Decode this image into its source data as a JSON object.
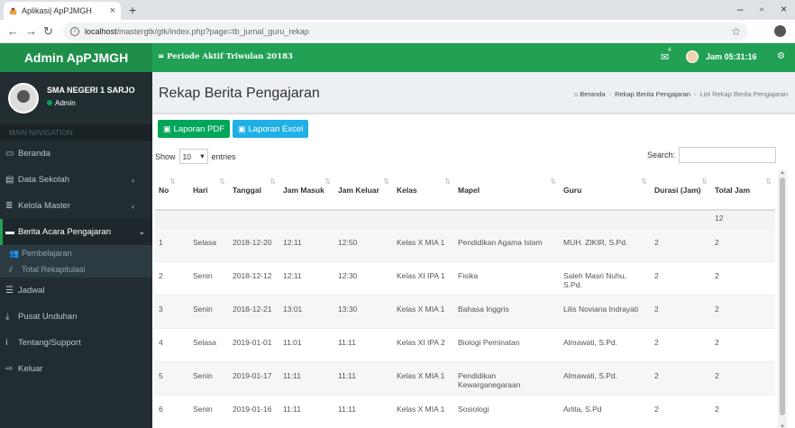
{
  "browser": {
    "tab_title": "Aplikasi| ApPJMGH",
    "url_host": "localhost",
    "url_path": "/mastergtk/gtk/index.php?page=tb_jurnal_guru_rekap"
  },
  "header": {
    "logo": "Admin ApPJMGH",
    "period": "Periode Aktif Triwulan 20183",
    "mail_badge": "4",
    "clock": "Jam 05:31:16"
  },
  "sidebar": {
    "user_name": "SMA NEGERI 1 SARJO",
    "user_role": "Admin",
    "section": "MAIN NAVIGATION",
    "items": [
      {
        "label": "Beranda",
        "icon": "monitor-icon"
      },
      {
        "label": "Data Sekolah",
        "icon": "book-icon",
        "chevron": "‹"
      },
      {
        "label": "Kelola Master",
        "icon": "database-icon",
        "chevron": "‹"
      },
      {
        "label": "Berita Acara Pengajaran",
        "icon": "book-icon",
        "chevron": "⌄"
      },
      {
        "label": "Jadwal",
        "icon": "list-icon"
      },
      {
        "label": "Pusat Unduhan",
        "icon": "download-icon"
      },
      {
        "label": "Tentang/Support",
        "icon": "info-icon"
      },
      {
        "label": "Keluar",
        "icon": "signout-icon"
      }
    ],
    "subitems": [
      {
        "label": "Pembelajaran",
        "icon": "users-icon"
      },
      {
        "label": "Total Rekapitulasi",
        "icon": "chart-icon"
      }
    ]
  },
  "content": {
    "title": "Rekap Berita Pengajaran",
    "crumbs": {
      "home": "Beranda",
      "mid": "Rekap Berita Pengajaran",
      "last": "List Rekap Berita Pengajaran"
    },
    "btn_pdf": "Laporan PDF",
    "btn_excel": "Laporan Excel",
    "show_label": "Show",
    "entries_value": "10",
    "entries_label": "entries",
    "search_label": "Search:"
  },
  "table": {
    "headers": [
      "No",
      "Hari",
      "Tanggal",
      "Jam Masuk",
      "Jam Keluar",
      "Kelas",
      "Mapel",
      "Guru",
      "Durasi (Jam)",
      "Total Jam"
    ],
    "total_value": "12",
    "rows": [
      {
        "no": "1",
        "hari": "Selasa",
        "tanggal": "2018-12-20",
        "masuk": "12:11",
        "keluar": "12:50",
        "kelas": "Kelas X MIA 1",
        "mapel": "Pendidikan Agama Islam",
        "guru": "MUH. ZIKIR, S.Pd.",
        "durasi": "2",
        "total": "2"
      },
      {
        "no": "2",
        "hari": "Senin",
        "tanggal": "2018-12-12",
        "masuk": "12:11",
        "keluar": "12:30",
        "kelas": "Kelas XI IPA 1",
        "mapel": "Fisika",
        "guru": "Saleh Masri Nuhu, S.Pd.",
        "durasi": "2",
        "total": "2"
      },
      {
        "no": "3",
        "hari": "Senin",
        "tanggal": "2018-12-21",
        "masuk": "13:01",
        "keluar": "13:30",
        "kelas": "Kelas X MIA 1",
        "mapel": "Bahasa Inggris",
        "guru": "Lilis Noviana Indrayati",
        "durasi": "2",
        "total": "2"
      },
      {
        "no": "4",
        "hari": "Selasa",
        "tanggal": "2019-01-01",
        "masuk": "11:01",
        "keluar": "11:11",
        "kelas": "Kelas XI IPA 2",
        "mapel": "Biologi Peminatan",
        "guru": "Almawati, S.Pd.",
        "durasi": "2",
        "total": "2"
      },
      {
        "no": "5",
        "hari": "Senin",
        "tanggal": "2019-01-17",
        "masuk": "11:11",
        "keluar": "11:11",
        "kelas": "Kelas X MIA 1",
        "mapel": "Pendidikan Kewarganegaraan",
        "guru": "Almawati, S.Pd.",
        "durasi": "2",
        "total": "2"
      },
      {
        "no": "6",
        "hari": "Senin",
        "tanggal": "2019-01-16",
        "masuk": "11:11",
        "keluar": "11:11",
        "kelas": "Kelas X MIA 1",
        "mapel": "Sosiologi",
        "guru": "Arlita, S.Pd",
        "durasi": "2",
        "total": "2"
      }
    ]
  }
}
